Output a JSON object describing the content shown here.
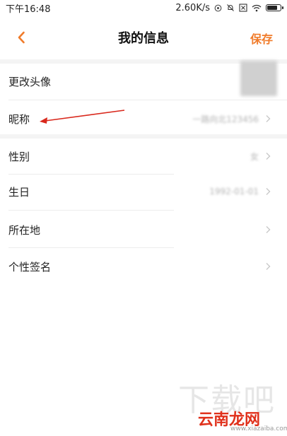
{
  "status_bar": {
    "time": "下午16:48",
    "network_speed": "2.60K/s",
    "icons": [
      "data-saver-icon",
      "mute-bell-icon",
      "sim-x-icon",
      "wifi-icon",
      "battery-icon"
    ]
  },
  "header": {
    "title": "我的信息",
    "save_label": "保存",
    "back_icon": "chevron-left-icon"
  },
  "rows": [
    {
      "label": "更改头像",
      "value": ""
    },
    {
      "label": "昵称",
      "value": "一路向北123456"
    },
    {
      "label": "性别",
      "value": "女"
    },
    {
      "label": "生日",
      "value": "1992-01-01"
    },
    {
      "label": "所在地",
      "value": ""
    },
    {
      "label": "个性签名",
      "value": ""
    }
  ],
  "watermark": {
    "big": "下载吧",
    "brand": "云南龙网",
    "url": "www.xiazaiba.com"
  },
  "colors": {
    "accent": "#f07b2a",
    "annotation": "#d9281c"
  },
  "battery_level": 0.85
}
